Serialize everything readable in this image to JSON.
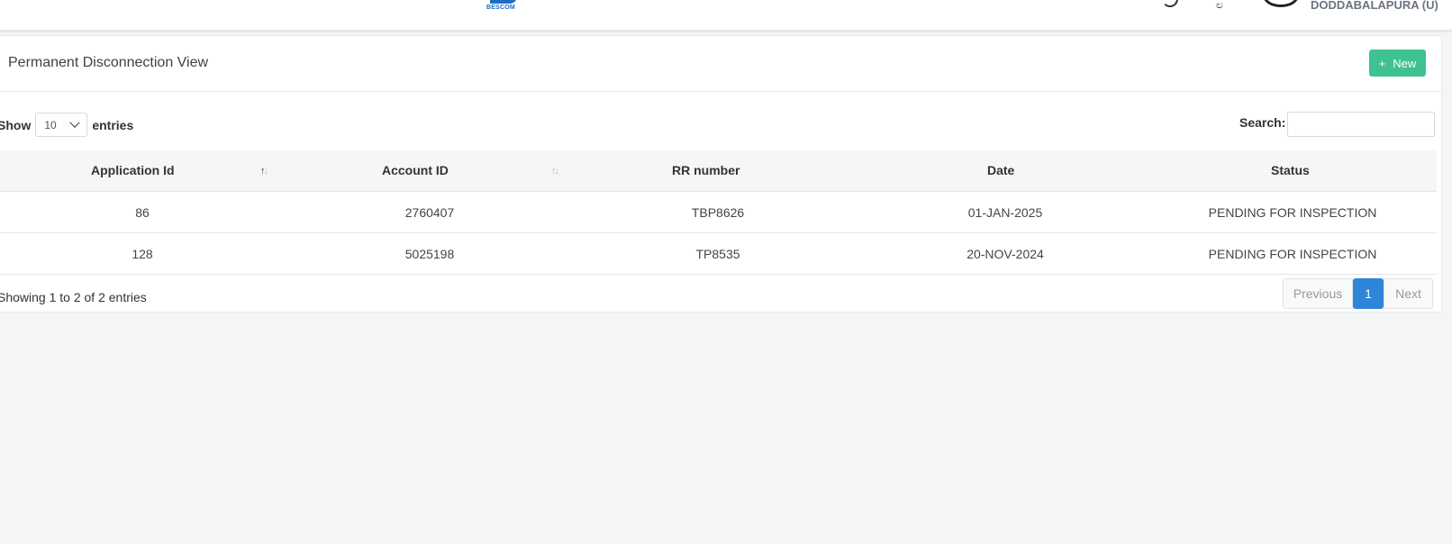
{
  "header": {
    "logo_text": "BESCOM",
    "user_name": "DODDABALAPURA (U)"
  },
  "page": {
    "title": "Permanent Disconnection View",
    "new_label": "New"
  },
  "table_controls": {
    "show_label": "Show",
    "entries_value": "10",
    "entries_label": "entries",
    "search_label": "Search:",
    "search_value": ""
  },
  "table": {
    "columns": [
      "Application Id",
      "Account ID",
      "RR number",
      "Date",
      "Status"
    ],
    "rows": [
      [
        "86",
        "2760407",
        "TBP8626",
        "01-JAN-2025",
        "PENDING FOR INSPECTION"
      ],
      [
        "128",
        "5025198",
        "TP8535",
        "20-NOV-2024",
        "PENDING FOR INSPECTION"
      ]
    ]
  },
  "footer": {
    "info": "Showing 1 to 2 of 2 entries",
    "previous": "Previous",
    "current_page": "1",
    "next": "Next"
  },
  "icons": [
    "plus-icon",
    "chevron-down-icon",
    "sort-icon",
    "notification-icon",
    "settings-icon"
  ],
  "colors": {
    "new_button": "#3ec28f",
    "active_page": "#2e86d8",
    "brand": "#1d6fc2"
  }
}
